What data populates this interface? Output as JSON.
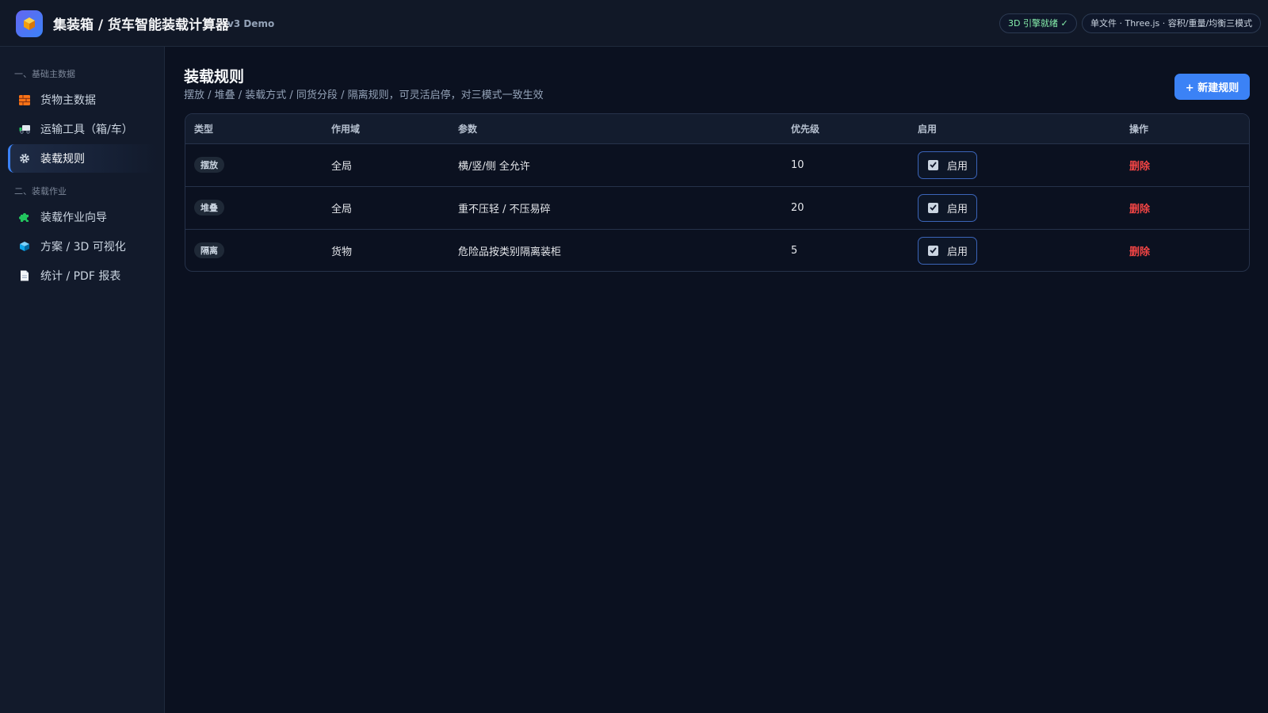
{
  "header": {
    "title": "集装箱 / 货车智能装载计算器",
    "version": "v3 Demo",
    "engine_badge": "3D 引擎就绪 ✓",
    "info_badge": "单文件 · Three.js · 容积/重量/均衡三模式",
    "logo_icon": "package-box-icon"
  },
  "sidebar": {
    "sections": [
      {
        "label": "一、基础主数据",
        "items": [
          {
            "label": "货物主数据",
            "icon": "bricks-icon",
            "active": false
          },
          {
            "label": "运输工具（箱/车）",
            "icon": "truck-icon",
            "active": false
          },
          {
            "label": "装载规则",
            "icon": "gear-icon",
            "active": true
          }
        ]
      },
      {
        "label": "二、装载作业",
        "items": [
          {
            "label": "装载作业向导",
            "icon": "puzzle-icon",
            "active": false
          },
          {
            "label": "方案 / 3D 可视化",
            "icon": "cube-icon",
            "active": false
          },
          {
            "label": "统计 / PDF 报表",
            "icon": "document-icon",
            "active": false
          }
        ]
      }
    ]
  },
  "main": {
    "title": "装载规则",
    "subtitle": "摆放 / 堆叠 / 装载方式 / 同货分段 / 隔离规则，可灵活启停，对三模式一致生效",
    "new_button": "+ 新建规则",
    "table": {
      "columns": [
        "类型",
        "作用域",
        "参数",
        "优先级",
        "启用",
        "操作"
      ],
      "rows": [
        {
          "type": "摆放",
          "scope": "全局",
          "params": "横/竖/侧 全允许",
          "priority": "10",
          "enabled_label": "启用",
          "enabled": true,
          "action": "删除"
        },
        {
          "type": "堆叠",
          "scope": "全局",
          "params": "重不压轻 / 不压易碎",
          "priority": "20",
          "enabled_label": "启用",
          "enabled": true,
          "action": "删除"
        },
        {
          "type": "隔离",
          "scope": "货物",
          "params": "危险品按类别隔离装柜",
          "priority": "5",
          "enabled_label": "启用",
          "enabled": true,
          "action": "删除"
        }
      ]
    }
  },
  "colors": {
    "accent": "#3b82f6",
    "danger": "#ef4444",
    "success": "#86efac",
    "background": "#0b1120",
    "sidebar": "#121a2b"
  }
}
